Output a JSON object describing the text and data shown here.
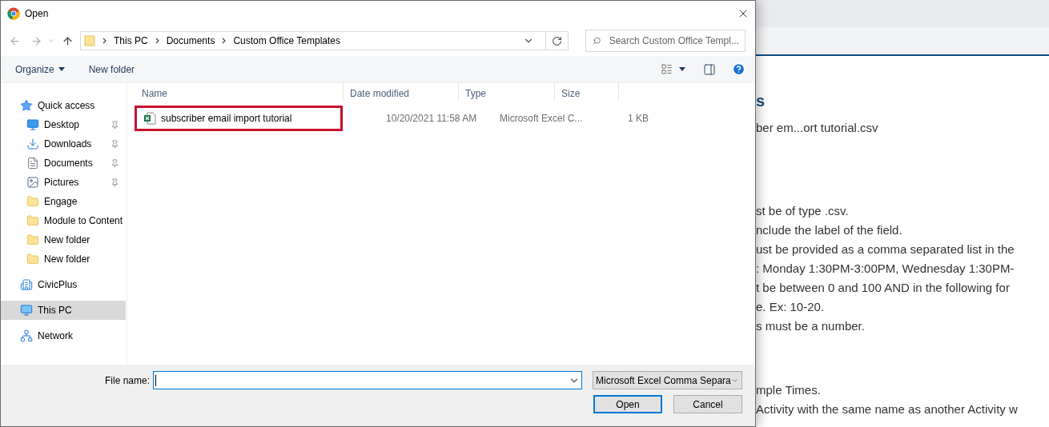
{
  "window": {
    "title": "Open"
  },
  "address": {
    "breadcrumbs": [
      "This PC",
      "Documents",
      "Custom Office Templates"
    ]
  },
  "search": {
    "placeholder": "Search Custom Office Templ..."
  },
  "toolbar": {
    "organize": "Organize",
    "new_folder": "New folder"
  },
  "sidebar": {
    "items": [
      {
        "label": "Quick access",
        "kind": "star",
        "selected": false,
        "children": [
          {
            "label": "Desktop",
            "kind": "desktop",
            "pinned": true,
            "selected": false
          },
          {
            "label": "Downloads",
            "kind": "download",
            "pinned": true,
            "selected": false
          },
          {
            "label": "Documents",
            "kind": "document",
            "pinned": true,
            "selected": false
          },
          {
            "label": "Pictures",
            "kind": "picture",
            "pinned": true,
            "selected": false
          },
          {
            "label": "Engage",
            "kind": "folder",
            "pinned": false,
            "selected": false
          },
          {
            "label": "Module to Content",
            "kind": "folder",
            "pinned": false,
            "selected": false
          },
          {
            "label": "New folder",
            "kind": "folder",
            "pinned": false,
            "selected": false
          },
          {
            "label": "New folder",
            "kind": "folder",
            "pinned": false,
            "selected": false
          }
        ]
      },
      {
        "label": "CivicPlus",
        "kind": "building",
        "selected": false
      },
      {
        "label": "This PC",
        "kind": "computer",
        "selected": true
      },
      {
        "label": "Network",
        "kind": "network",
        "selected": false
      }
    ]
  },
  "file_list": {
    "columns": [
      "Name",
      "Date modified",
      "Type",
      "Size"
    ],
    "rows": [
      {
        "name": "subscriber email import tutorial",
        "date_modified": "10/20/2021 11:58 AM",
        "type": "Microsoft Excel C...",
        "size": "1 KB",
        "highlighted": true
      }
    ]
  },
  "footer": {
    "file_name_label": "File name:",
    "file_type": "Microsoft Excel Comma Separa",
    "buttons": [
      "Open",
      "Cancel"
    ]
  },
  "background_page": {
    "heading": "s",
    "file": "ber em...ort tutorial.csv",
    "rules": [
      "st be of type .csv.",
      "nclude the label of the field.",
      "ust be provided as a comma separated list in the",
      ": Monday 1:30PM-3:00PM, Wednesday 1:30PM-",
      "t be between 0 and 100 AND in the following for",
      "e. Ex: 10-20.",
      "s must be a number."
    ],
    "notes": [
      "mple Times.",
      "Activity with the same name as another Activity w"
    ]
  }
}
